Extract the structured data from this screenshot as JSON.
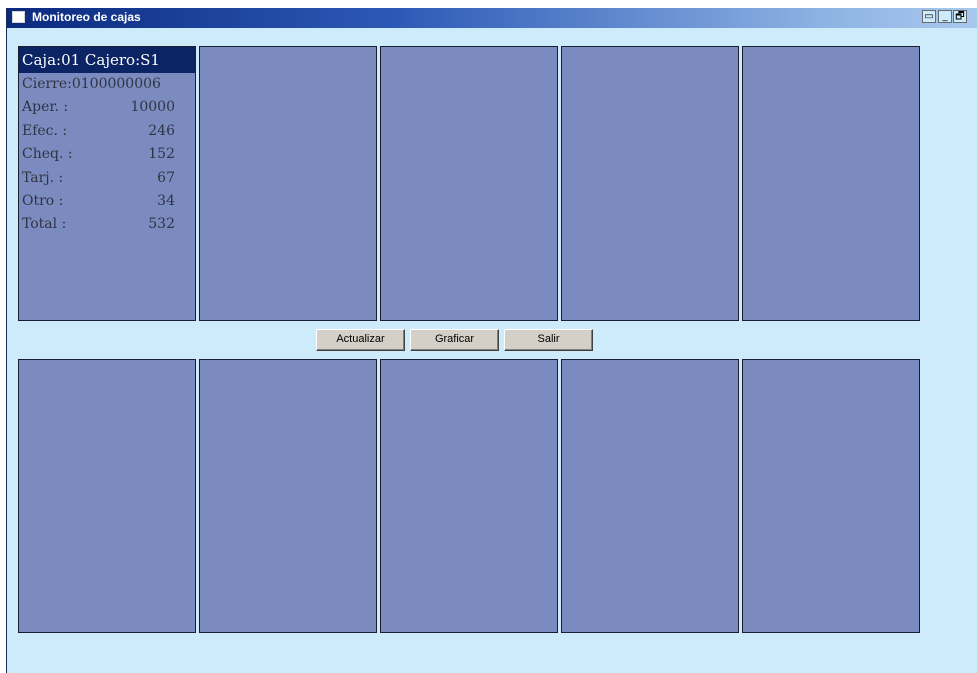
{
  "window": {
    "title": "Monitoreo de cajas"
  },
  "title_controls": [
    "▭",
    "_",
    "🗗"
  ],
  "top_panels": [
    {
      "header": "Caja:01 Cajero:S1",
      "lines": [
        {
          "label": "Cierre:0100000006",
          "value": ""
        },
        {
          "label": "Aper. :",
          "value": "10000"
        },
        {
          "label": "Efec. :",
          "value": "246"
        },
        {
          "label": "Cheq. :",
          "value": "152"
        },
        {
          "label": "Tarj. :",
          "value": "67"
        },
        {
          "label": "Otro  :",
          "value": "34"
        },
        {
          "label": "Total :",
          "value": "532"
        }
      ]
    },
    {},
    {},
    {},
    {}
  ],
  "buttons": {
    "actualizar": "Actualizar",
    "graficar": "Graficar",
    "salir": "Salir"
  },
  "colors": {
    "background": "#cdebfb",
    "panel": "#7c8bbf",
    "panel_header": "#0b2463"
  }
}
